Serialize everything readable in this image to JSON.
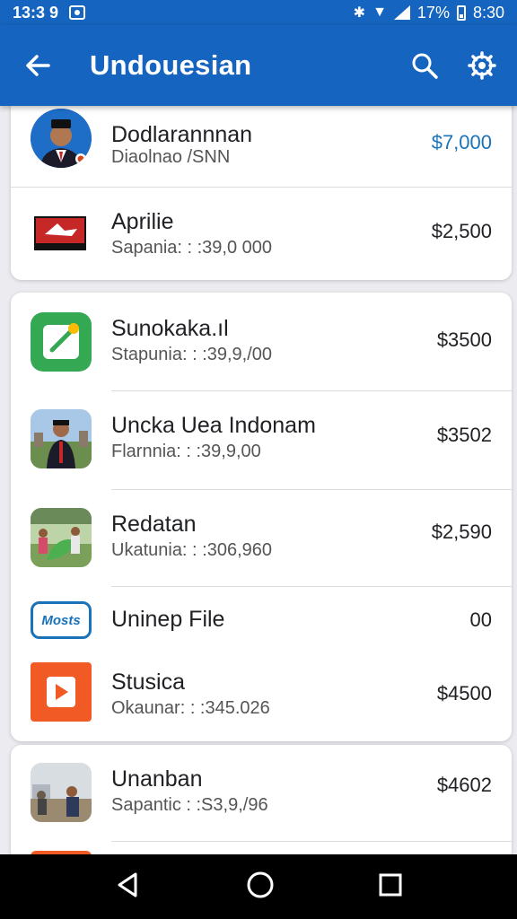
{
  "status_bar": {
    "time": "13:3 9",
    "battery": "17%",
    "clock": "8:30"
  },
  "app_bar": {
    "title": "Undouesian"
  },
  "items": [
    {
      "name": "Dodlarannnan",
      "sub": "Diaolnao /SNN",
      "amount": "$7,000",
      "amount_color": "#1a73b8"
    },
    {
      "name": "Aprilie",
      "sub": "Sapania: : :39,0 000",
      "amount": "$2,500"
    },
    {
      "name": "Sunokaka.ıl",
      "sub": "Stapunia: : :39,9,/00",
      "amount": "$3500"
    },
    {
      "name": "Uncka Uea Indonam",
      "sub": "Flarnnia: : :39,9,00",
      "amount": "$3502"
    },
    {
      "name": "Redatan",
      "sub": "Ukatunia: : :306,960",
      "amount": "$2,590"
    },
    {
      "name": "Uninep File",
      "sub": "",
      "amount": "00",
      "logo_text": "Mosts"
    },
    {
      "name": "Stusica",
      "sub": "Okaunar: : :345.026",
      "amount": "$4500"
    },
    {
      "name": "Unanban",
      "sub": "Sapantic : :S3,9,/96",
      "amount": "$4602"
    }
  ],
  "colors": {
    "primary": "#1565c0",
    "accent_amount": "#1a73b8",
    "green_app": "#34a853",
    "orange_app": "#f15a24"
  }
}
